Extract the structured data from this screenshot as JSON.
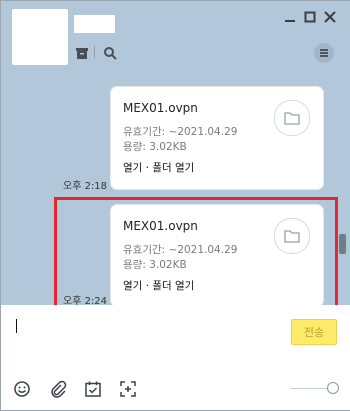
{
  "messages": [
    {
      "file_name": "MEX01.ovpn",
      "expiry": "유효기간: ~2021.04.29",
      "size": "용량: 3.02KB",
      "actions": "열기 · 폴더 열기",
      "time": "오후 2:18"
    },
    {
      "file_name": "MEX01.ovpn",
      "expiry": "유효기간: ~2021.04.29",
      "size": "용량: 3.02KB",
      "actions": "열기 · 폴더 열기",
      "time": "오후 2:24"
    }
  ],
  "composer": {
    "send_label": "전송"
  },
  "icons": [
    "archive-icon",
    "search-icon",
    "minimize-icon",
    "maximize-icon",
    "close-icon",
    "menu-icon",
    "folder-icon",
    "emoji-icon",
    "attach-icon",
    "calendar-check-icon",
    "capture-icon"
  ],
  "colors": {
    "chat_background": "#b2c7d9",
    "send_button": "#fdeb69",
    "highlight_box": "#e2282e"
  }
}
